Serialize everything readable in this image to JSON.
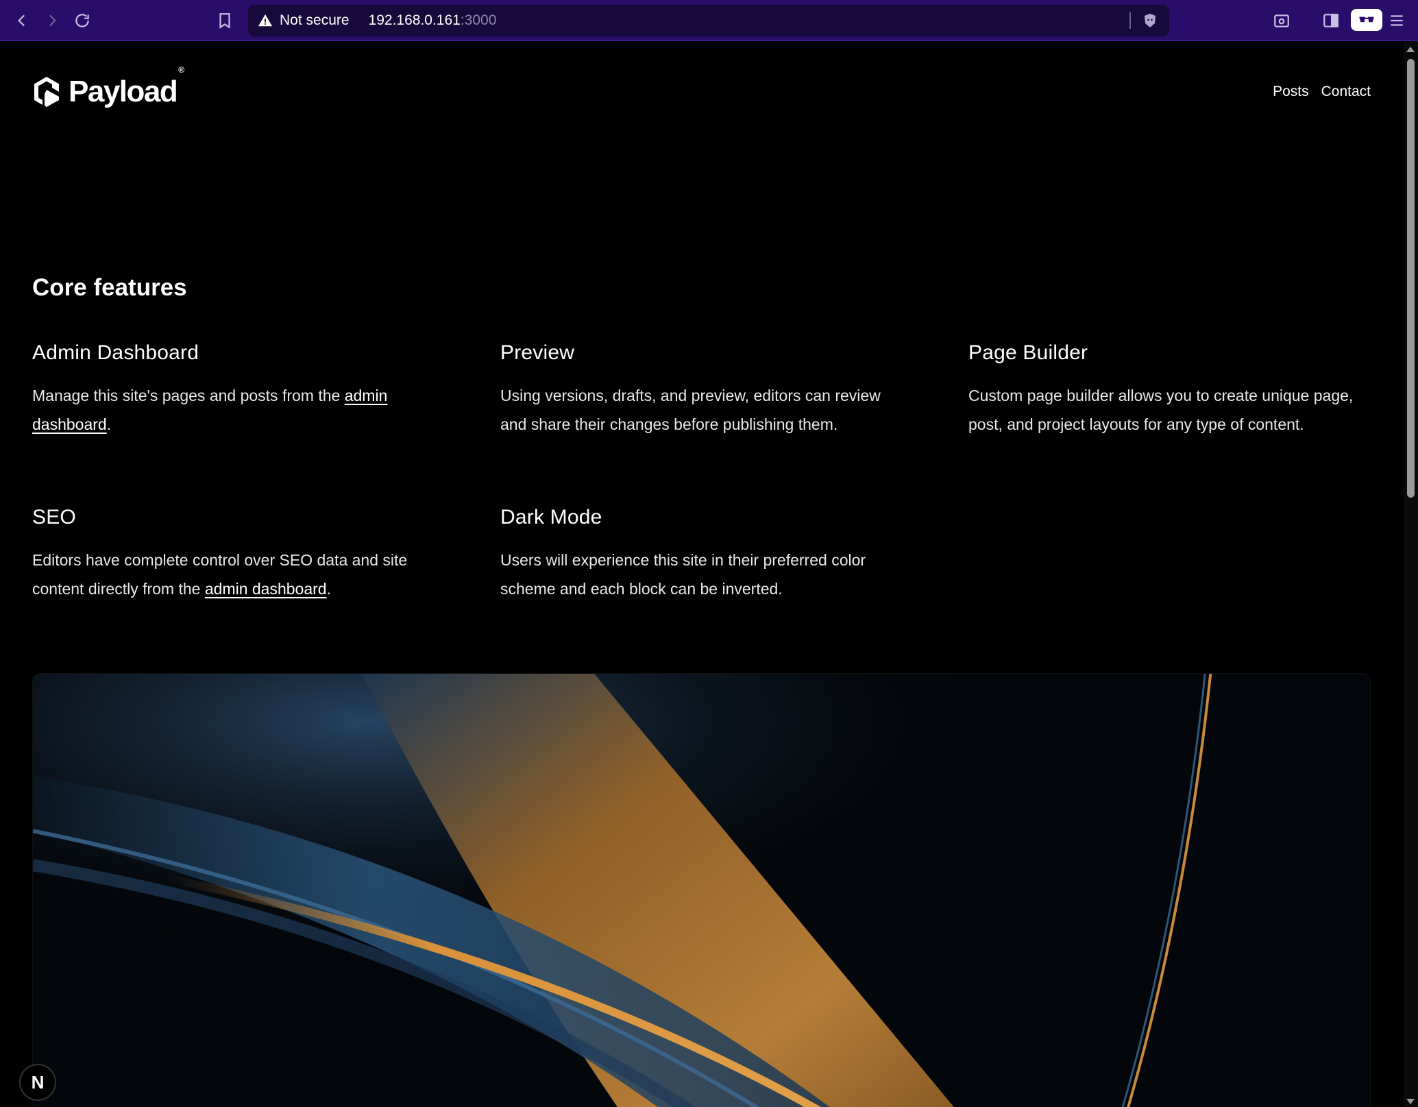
{
  "browser": {
    "security_label": "Not secure",
    "url_host": "192.168.0.161",
    "url_port": ":3000"
  },
  "site": {
    "logo_text": "Payload",
    "logo_reg": "®",
    "nav": [
      "Posts",
      "Contact"
    ]
  },
  "features_section": {
    "title": "Core features",
    "items": [
      {
        "title": "Admin Dashboard",
        "text_before": "Manage this site's pages and posts from the ",
        "link": "admin dashboard",
        "text_after": "."
      },
      {
        "title": "Preview",
        "text": "Using versions, drafts, and preview, editors can review and share their changes before publishing them."
      },
      {
        "title": "Page Builder",
        "text": "Custom page builder allows you to create unique page, post, and project layouts for any type of content."
      },
      {
        "title": "SEO",
        "text_before": "Editors have complete control over SEO data and site content directly from the ",
        "link": "admin dashboard",
        "text_after": "."
      },
      {
        "title": "Dark Mode",
        "text": "Users will experience this site in their preferred color scheme and each block can be inverted."
      }
    ]
  },
  "dev_badge": {
    "label": "N"
  },
  "colors": {
    "chrome_bg": "#2a0c6b",
    "page_bg": "#000000",
    "accent_orange": "#d9913a",
    "accent_blue": "#2c5a86"
  }
}
